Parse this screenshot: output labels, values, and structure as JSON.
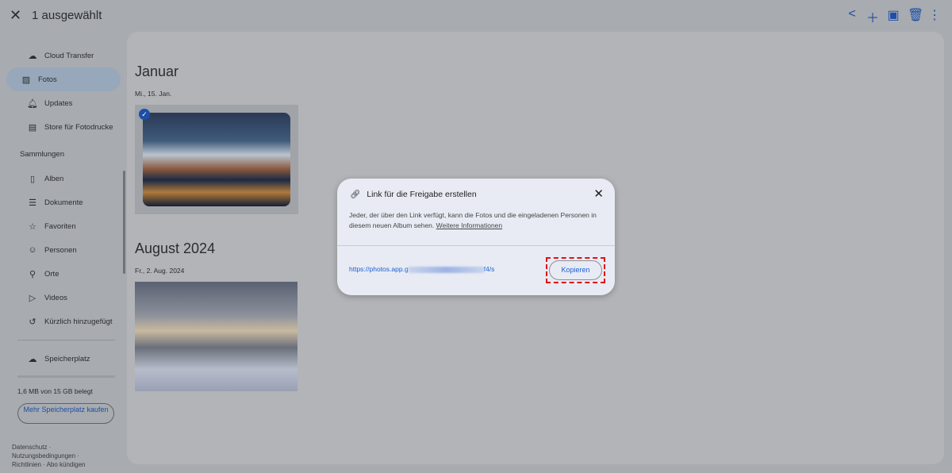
{
  "header": {
    "title": "1 ausgewählt",
    "actions": [
      "share-icon",
      "add-icon",
      "shopping-bag-icon",
      "trash-icon",
      "more-vert-icon"
    ]
  },
  "sidebar": {
    "items": [
      {
        "label": "Cloud Transfer",
        "icon": "cloud-upload-icon"
      },
      {
        "label": "Fotos",
        "icon": "photo-icon",
        "active": true
      },
      {
        "label": "Updates",
        "icon": "bell-icon"
      },
      {
        "label": "Store für Fotodrucke",
        "icon": "store-icon"
      }
    ],
    "section": "Sammlungen",
    "collections": [
      {
        "label": "Alben"
      },
      {
        "label": "Dokumente"
      },
      {
        "label": "Favoriten"
      },
      {
        "label": "Personen"
      },
      {
        "label": "Orte"
      },
      {
        "label": "Videos"
      },
      {
        "label": "Kürzlich hinzugefügt"
      }
    ],
    "storage_label": "Speicherplatz",
    "storage_used": "1,6 MB von 15 GB belegt",
    "storage_fraction": 0.0001,
    "buy_label": "Mehr Speicherplatz kaufen",
    "footer": {
      "privacy": "Datenschutz",
      "terms": "Nutzungsbedingungen",
      "policies": "Richtlinien",
      "cancel": "Abo kündigen"
    }
  },
  "main": {
    "groups": [
      {
        "month": "Januar",
        "date": "Mi., 15. Jan."
      },
      {
        "month": "August 2024",
        "date": "Fr., 2. Aug. 2024"
      }
    ]
  },
  "dialog": {
    "title": "Link für die Freigabe erstellen",
    "body": "Jeder, der über den Link verfügt, kann die Fotos und die eingeladenen Personen in diesem neuen Album sehen.",
    "more_link": "Weitere Informationen",
    "url": "https://photos.app.g",
    "url_end": "f4/s",
    "copy_label": "Kopieren",
    "highlight_color": "#e0101a"
  }
}
